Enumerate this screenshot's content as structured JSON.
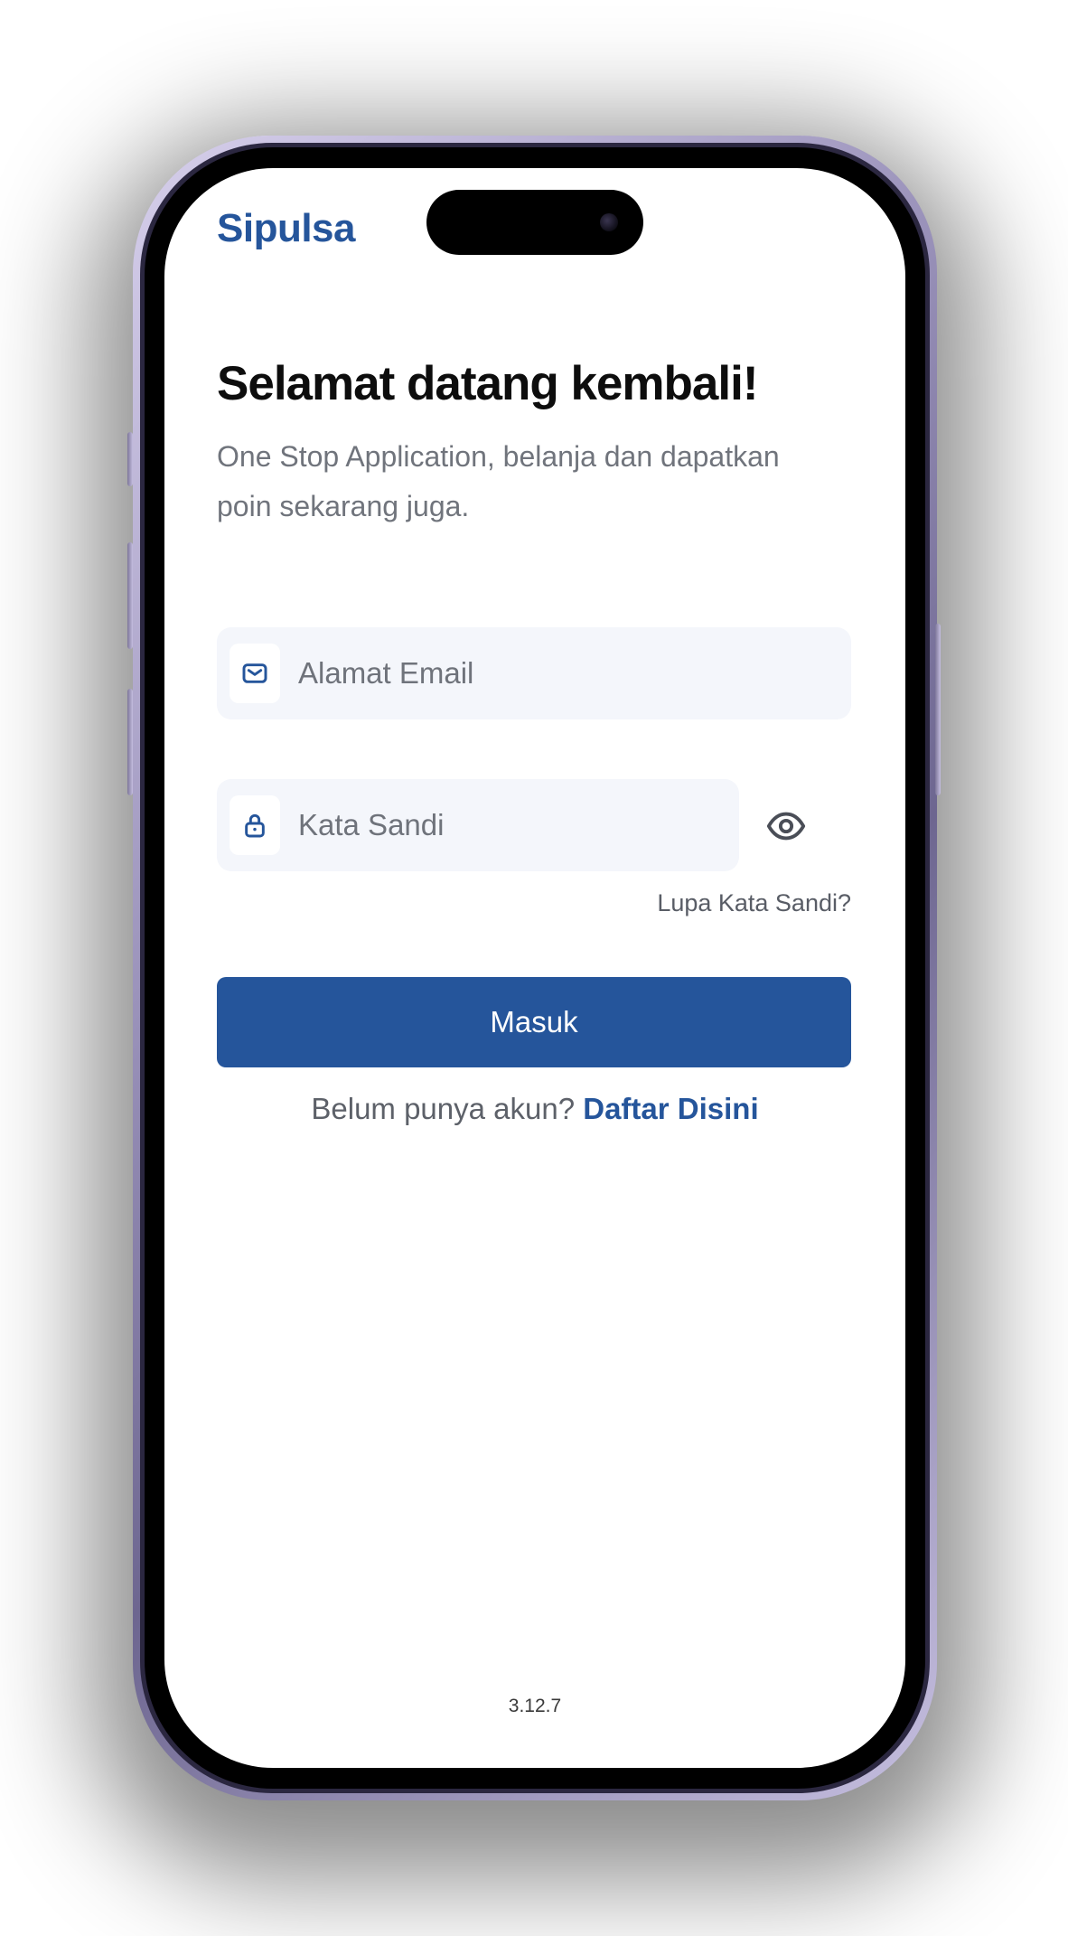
{
  "app": {
    "brand": "Sipulsa"
  },
  "login": {
    "title": "Selamat datang kembali!",
    "subtitle": "One Stop Application, belanja dan dapatkan poin sekarang juga.",
    "email": {
      "placeholder": "Alamat Email",
      "value": "",
      "icon": "mail-icon"
    },
    "password": {
      "placeholder": "Kata Sandi",
      "value": "",
      "icon": "lock-icon",
      "toggle_icon": "eye-icon"
    },
    "forgot_label": "Lupa Kata Sandi?",
    "submit_label": "Masuk",
    "register_prompt": "Belum punya akun?",
    "register_link": "Daftar Disini"
  },
  "footer": {
    "version": "3.12.7"
  },
  "colors": {
    "brand": "#25559b",
    "field_background": "#f4f6fb",
    "muted_text": "#70747c",
    "heading": "#0d0d0d"
  }
}
